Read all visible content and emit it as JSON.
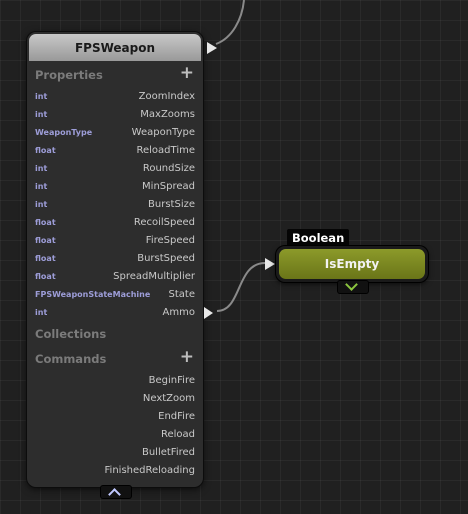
{
  "node": {
    "title": "FPSWeapon",
    "sections": {
      "properties": "Properties",
      "collections": "Collections",
      "commands": "Commands"
    },
    "properties": [
      {
        "type": "int",
        "name": "ZoomIndex"
      },
      {
        "type": "int",
        "name": "MaxZooms"
      },
      {
        "type": "WeaponType",
        "name": "WeaponType"
      },
      {
        "type": "float",
        "name": "ReloadTime"
      },
      {
        "type": "int",
        "name": "RoundSize"
      },
      {
        "type": "int",
        "name": "MinSpread"
      },
      {
        "type": "int",
        "name": "BurstSize"
      },
      {
        "type": "float",
        "name": "RecoilSpeed"
      },
      {
        "type": "float",
        "name": "FireSpeed"
      },
      {
        "type": "float",
        "name": "BurstSpeed"
      },
      {
        "type": "float",
        "name": "SpreadMultiplier"
      },
      {
        "type": "FPSWeaponStateMachine",
        "name": "State"
      },
      {
        "type": "int",
        "name": "Ammo"
      }
    ],
    "commands": [
      "BeginFire",
      "NextZoom",
      "EndFire",
      "Reload",
      "BulletFired",
      "FinishedReloading"
    ],
    "add_symbol": "+"
  },
  "computed_node": {
    "return_type": "Boolean",
    "title": "IsEmpty"
  },
  "colors": {
    "header": "#b4b4b4",
    "type_text": "#9d9dd8",
    "computed_fill": "#7c8a22",
    "wire": "#8c8c8c"
  }
}
